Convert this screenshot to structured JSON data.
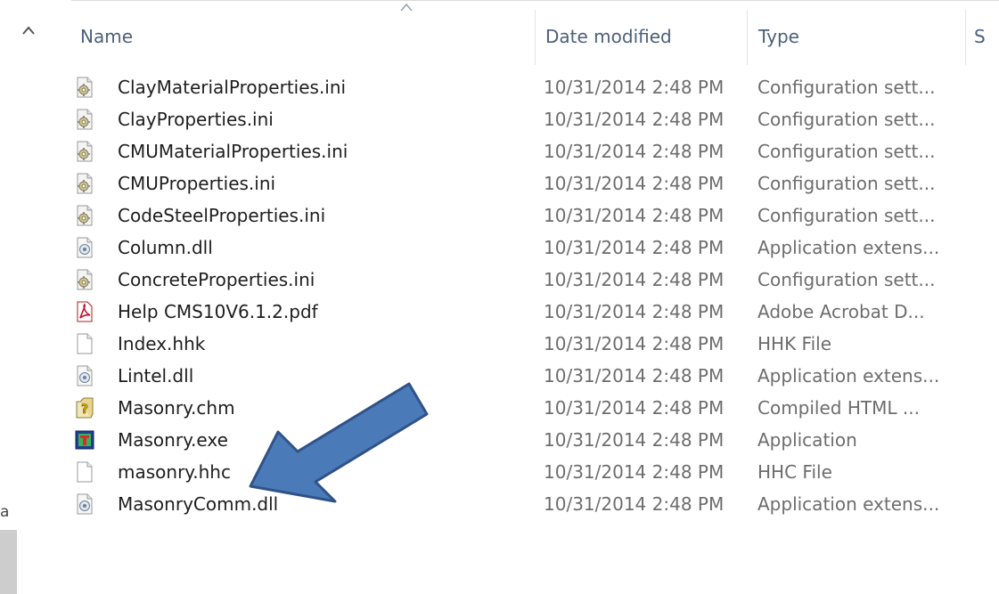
{
  "columns": {
    "name": "Name",
    "date_modified": "Date modified",
    "type": "Type",
    "size": "S"
  },
  "nav_fragment": "a",
  "files": [
    {
      "name": "ClayMaterialProperties.ini",
      "date": "10/31/2014 2:48 PM",
      "type": "Configuration sett...",
      "icon": "config-file-icon"
    },
    {
      "name": "ClayProperties.ini",
      "date": "10/31/2014 2:48 PM",
      "type": "Configuration sett...",
      "icon": "config-file-icon"
    },
    {
      "name": "CMUMaterialProperties.ini",
      "date": "10/31/2014 2:48 PM",
      "type": "Configuration sett...",
      "icon": "config-file-icon"
    },
    {
      "name": "CMUProperties.ini",
      "date": "10/31/2014 2:48 PM",
      "type": "Configuration sett...",
      "icon": "config-file-icon"
    },
    {
      "name": "CodeSteelProperties.ini",
      "date": "10/31/2014 2:48 PM",
      "type": "Configuration sett...",
      "icon": "config-file-icon"
    },
    {
      "name": "Column.dll",
      "date": "10/31/2014 2:48 PM",
      "type": "Application extens...",
      "icon": "dll-file-icon"
    },
    {
      "name": "ConcreteProperties.ini",
      "date": "10/31/2014 2:48 PM",
      "type": "Configuration sett...",
      "icon": "config-file-icon"
    },
    {
      "name": "Help CMS10V6.1.2.pdf",
      "date": "10/31/2014 2:48 PM",
      "type": "Adobe Acrobat D...",
      "icon": "pdf-file-icon"
    },
    {
      "name": "Index.hhk",
      "date": "10/31/2014 2:48 PM",
      "type": "HHK File",
      "icon": "blank-file-icon"
    },
    {
      "name": "Lintel.dll",
      "date": "10/31/2014 2:48 PM",
      "type": "Application extens...",
      "icon": "dll-file-icon"
    },
    {
      "name": "Masonry.chm",
      "date": "10/31/2014 2:48 PM",
      "type": "Compiled HTML ...",
      "icon": "chm-help-icon"
    },
    {
      "name": "Masonry.exe",
      "date": "10/31/2014 2:48 PM",
      "type": "Application",
      "icon": "exe-app-icon"
    },
    {
      "name": "masonry.hhc",
      "date": "10/31/2014 2:48 PM",
      "type": "HHC File",
      "icon": "blank-file-icon"
    },
    {
      "name": "MasonryComm.dll",
      "date": "10/31/2014 2:48 PM",
      "type": "Application extens...",
      "icon": "dll-file-icon"
    }
  ],
  "colors": {
    "header_text": "#4c607a",
    "meta_text": "#6d6d6d",
    "annotation_arrow_fill": "#4a7ab8",
    "annotation_arrow_stroke": "#2f5288"
  }
}
